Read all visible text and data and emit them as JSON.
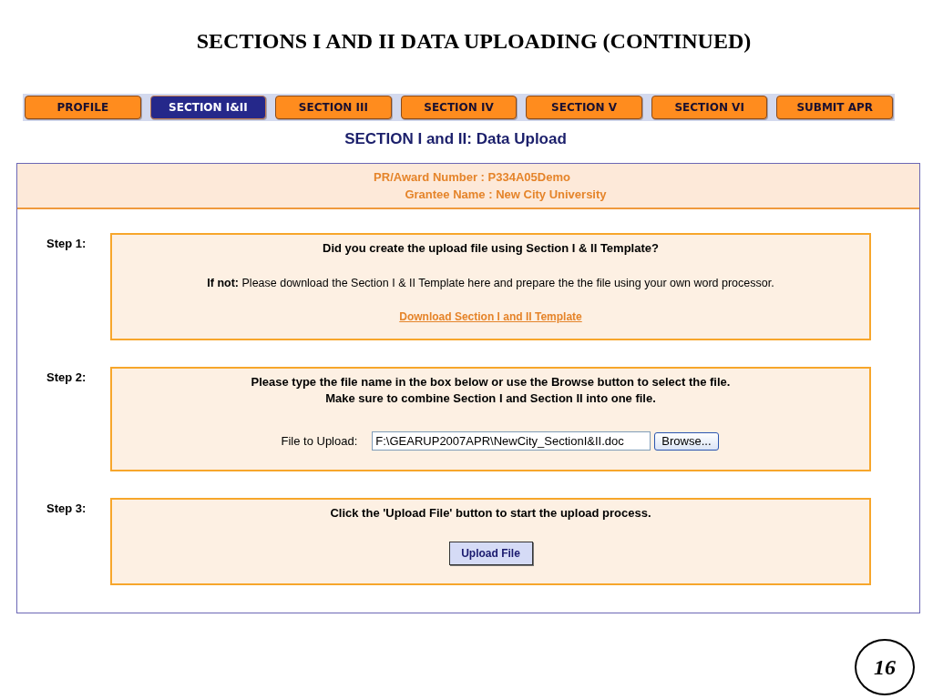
{
  "slide_title": "SECTIONS I AND II DATA UPLOADING (CONTINUED)",
  "tabs": [
    {
      "label": "PROFILE",
      "selected": false
    },
    {
      "label": "SECTION I&II",
      "selected": true
    },
    {
      "label": "SECTION III",
      "selected": false
    },
    {
      "label": "SECTION IV",
      "selected": false
    },
    {
      "label": "SECTION V",
      "selected": false
    },
    {
      "label": "SECTION VI",
      "selected": false
    },
    {
      "label": "SUBMIT APR",
      "selected": false
    }
  ],
  "page_heading": "SECTION I and II: Data Upload",
  "award_info": {
    "award_number": "PR/Award Number : P334A05Demo",
    "grantee_name": "Grantee Name : New City University"
  },
  "steps": [
    {
      "label": "Step 1:",
      "kind": "download",
      "question": "Did you create the upload file using Section I & II Template?",
      "note": "**If not:** Please download the Section I & II Template here and prepare the the file using your own word processor.",
      "link": "Download Section I and II Template"
    },
    {
      "label": "Step 2:",
      "kind": "file",
      "instructions": [
        "Please type the file name in the box below or use the Browse button to select the file.",
        "Make sure to combine Section I and Section II into one file."
      ],
      "field_label": "File to Upload:",
      "file_value": "F:\\GEARUP2007APR\\NewCity_SectionI&II.doc",
      "browse_button": "Browse..."
    },
    {
      "label": "Step 3:",
      "kind": "upload",
      "instruction": "Click the 'Upload File' button to start the upload process.",
      "button": "Upload File"
    }
  ],
  "page_number": "16"
}
